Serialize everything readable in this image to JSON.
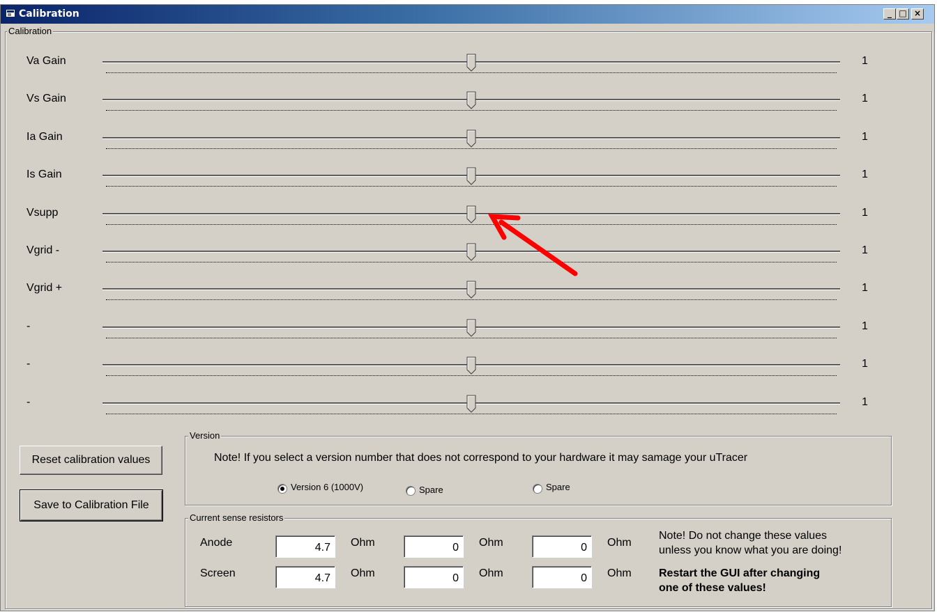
{
  "window": {
    "title": "Calibration",
    "minimize": "_",
    "maximize": "□",
    "close": "×"
  },
  "calibration_frame": {
    "label": "Calibration"
  },
  "sliders": [
    {
      "label": "Va Gain",
      "value": "1",
      "position": 0.5
    },
    {
      "label": "Vs Gain",
      "value": "1",
      "position": 0.5
    },
    {
      "label": "Ia Gain",
      "value": "1",
      "position": 0.5
    },
    {
      "label": "Is Gain",
      "value": "1",
      "position": 0.5
    },
    {
      "label": "Vsupp",
      "value": "1",
      "position": 0.5
    },
    {
      "label": "Vgrid -",
      "value": "1",
      "position": 0.5
    },
    {
      "label": "Vgrid +",
      "value": "1",
      "position": 0.5
    },
    {
      "label": "-",
      "value": "1",
      "position": 0.5
    },
    {
      "label": "-",
      "value": "1",
      "position": 0.5
    },
    {
      "label": "-",
      "value": "1",
      "position": 0.5
    }
  ],
  "buttons": {
    "reset": "Reset calibration values",
    "save": "Save to Calibration File"
  },
  "version": {
    "label": "Version",
    "note": "Note! If you select a version number that does not correspond to your hardware it may samage your uTracer",
    "options": [
      {
        "label": "Version 6 (1000V)",
        "selected": true
      },
      {
        "label": "Spare",
        "selected": false
      },
      {
        "label": "Spare",
        "selected": false
      }
    ]
  },
  "resistors": {
    "label": "Current sense resistors",
    "unit": "Ohm",
    "rows": [
      {
        "label": "Anode",
        "values": [
          "4.7",
          "0",
          "0"
        ]
      },
      {
        "label": "Screen",
        "values": [
          "4.7",
          "0",
          "0"
        ]
      }
    ],
    "note_line1": "Note!  Do not change these values",
    "note_line2": "unless you know what you are doing!",
    "warning_line1": "Restart the GUI after changing",
    "warning_line2": "one of these values!"
  },
  "annotation": {
    "arrow_color": "#ff0000"
  }
}
